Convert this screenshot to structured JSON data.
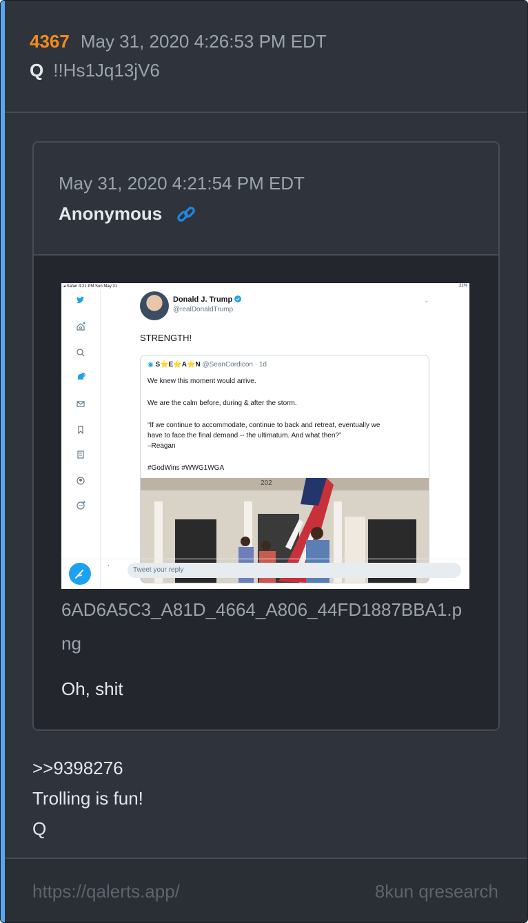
{
  "post": {
    "number": "4367",
    "date": "May 31, 2020 4:26:53 PM EDT",
    "author": "Q",
    "tripcode": "!!Hs1Jq13jV6"
  },
  "quoted": {
    "date": "May 31, 2020 4:21:54 PM EDT",
    "author": "Anonymous",
    "link_icon": "link-icon",
    "filename": "6AD6A5C3_A81D_4664_A806_44FD1887BBA1.png",
    "text": "Oh, shit",
    "image": {
      "status_left": "◂ Safari  4:21 PM   Sun May 31",
      "status_right": "21%",
      "tweet_name": "Donald J. Trump",
      "tweet_handle": "@realDonaldTrump",
      "tweet_text": "STRENGTH!",
      "quote_name": "S⭐E⭐A⭐N",
      "quote_meta": "@SeanCordicon · 1d",
      "quote_lines": [
        "We knew this moment would arrive.",
        "We are the calm before, during & after the storm.",
        "“If we continue to accommodate, continue to back and retreat, eventually we",
        "have to face the final demand -- the ultimatum. And what then?”",
        "–Reagan",
        "#GodWins #WWG1WGA"
      ],
      "house_number": "202",
      "reply_placeholder": "Tweet your reply",
      "notification_count": "2"
    }
  },
  "body": {
    "reference": ">>9398276",
    "line1": "Trolling is fun!",
    "signature": "Q"
  },
  "footer": {
    "url": "https://qalerts.app/",
    "source": "8kun qresearch"
  },
  "colors": {
    "accent": "#5aa6f0",
    "post_number": "#f28b1e",
    "link": "#1e88e5",
    "twitter_blue": "#1da1f2"
  }
}
